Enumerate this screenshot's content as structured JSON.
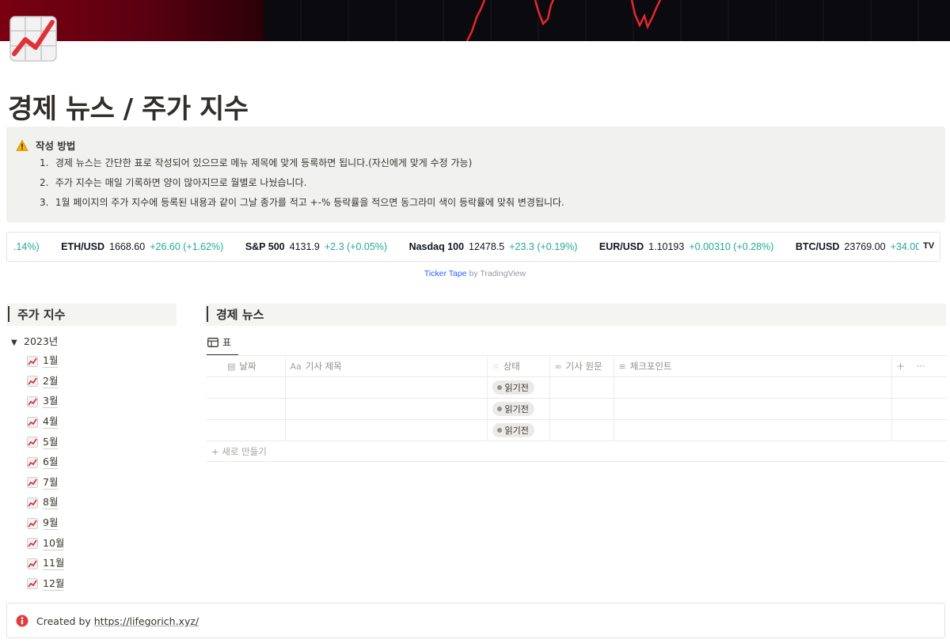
{
  "page": {
    "title": "경제 뉴스 / 주가 지수",
    "icon": "chart-increasing-icon",
    "cover": "stock-chart-cover"
  },
  "callout": {
    "icon": "warning-icon",
    "heading": "작성 방법",
    "items": [
      {
        "num": "1.",
        "text": "경제 뉴스는 간단한 표로 작성되어 있으므로 메뉴 제목에 맞게 등록하면 됩니다.(자신에게 맞게 수정 가능)"
      },
      {
        "num": "2.",
        "text": "주가 지수는 매일 기록하면 양이 많아지므로 월별로 나눴습니다."
      },
      {
        "num": "3.",
        "text": "1월 페이지의 주가 지수에 등록된 내용과 같이 그날 종가를 적고 +-% 등락률을 적으면 동그라미 색이 등락률에 맞춰 변경됩니다."
      }
    ]
  },
  "ticker": {
    "leading_fragment": ".14%)",
    "items": [
      {
        "symbol": "ETH/USD",
        "price": "1668.60",
        "change": "+26.60 (+1.62%)"
      },
      {
        "symbol": "S&P 500",
        "price": "4131.9",
        "change": "+2.3 (+0.05%)"
      },
      {
        "symbol": "Nasdaq 100",
        "price": "12478.5",
        "change": "+23.3 (+0.19%)"
      },
      {
        "symbol": "EUR/USD",
        "price": "1.10193",
        "change": "+0.00310 (+0.28%)"
      },
      {
        "symbol": "BTC/USD",
        "price": "23769.00",
        "change": "+34.00"
      }
    ],
    "logo": "TV",
    "credit_link": "Ticker Tape",
    "credit_suffix": " by TradingView",
    "colors": {
      "up": "#22ab94"
    }
  },
  "stock_section": {
    "title": "주가 지수",
    "year_toggle": "2023년",
    "months": [
      "1월",
      "2월",
      "3월",
      "4월",
      "5월",
      "6월",
      "7월",
      "8월",
      "9월",
      "10월",
      "11월",
      "12월"
    ]
  },
  "news_section": {
    "title": "경제 뉴스",
    "view_tab": "표",
    "columns": [
      {
        "icon": "calendar-icon",
        "label": "날짜"
      },
      {
        "icon": "text-aa-icon",
        "label": "기사 제목",
        "prefix": "Aa"
      },
      {
        "icon": "status-icon",
        "label": "상태"
      },
      {
        "icon": "link-icon",
        "label": "기사 원문"
      },
      {
        "icon": "lines-icon",
        "label": "체크포인트"
      }
    ],
    "header_actions": {
      "add": "+",
      "more": "···"
    },
    "rows": [
      {
        "date": "",
        "title": "",
        "status": "읽기전",
        "link": "",
        "checkpoint": ""
      },
      {
        "date": "",
        "title": "",
        "status": "읽기전",
        "link": "",
        "checkpoint": ""
      },
      {
        "date": "",
        "title": "",
        "status": "읽기전",
        "link": "",
        "checkpoint": ""
      }
    ],
    "new_row": "+ 새로 만들기"
  },
  "footer": {
    "icon": "info-icon",
    "prefix": "Created by ",
    "link": "https://lifegorich.xyz/"
  }
}
